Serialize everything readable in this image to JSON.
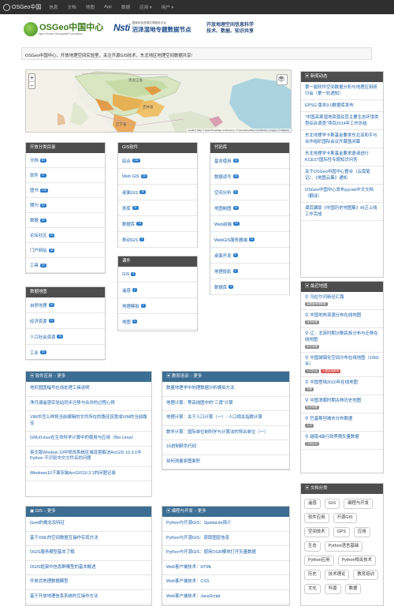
{
  "navbar": {
    "brand": "OSGeo中国",
    "items": [
      "信息",
      "文档",
      "地图",
      "App",
      "数据",
      "应用 ▾",
      "用户 ▾"
    ]
  },
  "header": {
    "osgeo_title_a": "OSGeo",
    "osgeo_title_b": "中国中心",
    "osgeo_sub": "Open Source Geospatial Foundation",
    "nsti_logo": "Nsti",
    "nsti_sub1": "国家科技资源共享服务平台",
    "nsti_sub2": "沼泽湿地专题数据节点",
    "slogan_line1": "开放地理空间信息科学",
    "slogan_line2": "技术、数据、知识共享"
  },
  "intro": "OSGeo中国中心，开放地理空间实验室，关注开源GIS技术，东北地区地理空间数据共享!",
  "map": {
    "zoom_in": "+",
    "zoom_out": "−",
    "attribution": "Leaflet | Map © OpenStreetMap contributors, © OpenStreetMap contributors, Imagery © Mapbox",
    "place_labels": [
      "黑龙江省",
      "吉林省",
      "辽宁省"
    ]
  },
  "panels": {
    "category": {
      "title": "开放分类目录",
      "items": [
        {
          "label": "文档",
          "count": "80"
        },
        {
          "label": "软件",
          "count": "27"
        },
        {
          "label": "图书",
          "count": "138"
        },
        {
          "label": "期刊",
          "count": "40"
        },
        {
          "label": "数据",
          "count": "25"
        },
        {
          "label": "论坛社区",
          "count": "10"
        },
        {
          "label": "门户网站",
          "count": "36"
        },
        {
          "label": "工具",
          "count": "20"
        }
      ]
    },
    "gis_soft": {
      "title": "GIS软件",
      "items": [
        {
          "label": "综合",
          "count": "182"
        },
        {
          "label": "Web GIS",
          "count": "34"
        },
        {
          "label": "桌面GIS",
          "count": "25"
        },
        {
          "label": "类库",
          "count": "31"
        },
        {
          "label": "数据库",
          "count": "13"
        },
        {
          "label": "移动GIS",
          "count": "9"
        }
      ]
    },
    "codebase": {
      "title": "代码库",
      "items": [
        {
          "label": "基本使用",
          "count": "22"
        },
        {
          "label": "数据读写",
          "count": "18"
        },
        {
          "label": "空间分析",
          "count": "8"
        },
        {
          "label": "地图制图",
          "count": "14"
        },
        {
          "label": "Web前端",
          "count": "19"
        },
        {
          "label": "WebGIS服务器端",
          "count": "11"
        },
        {
          "label": "桌面开发",
          "count": "5"
        },
        {
          "label": "地理投影",
          "count": "4"
        },
        {
          "label": "数据库",
          "count": "6"
        }
      ]
    },
    "courses": {
      "title": "课件",
      "items": [
        {
          "label": "GIS",
          "count": "3"
        },
        {
          "label": "遥感",
          "count": "2"
        },
        {
          "label": "地理模拟",
          "count": "2"
        },
        {
          "label": "地图",
          "count": "4"
        }
      ]
    },
    "dataset": {
      "title": "数据地图",
      "items": [
        {
          "label": "自然地理",
          "count": "42"
        },
        {
          "label": "经济资源",
          "count": "21"
        },
        {
          "label": "人口社会资源",
          "count": "38"
        },
        {
          "label": "工业",
          "count": "30"
        }
      ]
    },
    "news": {
      "title": "新闻动态",
      "items": [
        "第一届软件空间数据分析与地理应用研讨会（第一轮通知）",
        "EPSG 版本9.0数据库发布",
        "\"中国高寒湿地资源及其主要生态环境类型综合调查\"项目2014年工作总结",
        "东北地理学卡斯基金要求东北亚和平与合作组织国际会议开幕暨闭幕",
        "东北地理学卡斯基金要求邀请进行KCEST国际性专题知识问答",
        "关于OSGeo中国中心整合（云南笔记）、《地图云集》通知",
        "OSGeo中国中心发布pycsw中文文档（翻译）",
        "谭其骧版《中国历史地图集》纠正上线工作完成"
      ]
    },
    "recent_map": {
      "title": "最近地图",
      "items": [
        {
          "label": "乌拉尔河新径汇路",
          "tags": [
            "高精度地理数据"
          ],
          "red": false
        },
        {
          "label": "中国地热资源分布在线地图",
          "tags": [
            "自然地理"
          ],
          "red": false
        },
        {
          "label": "辽、北宋时期沙数民族分布与迁移在线地图",
          "tags": [
            "历史地理"
          ],
          "red": false
        },
        {
          "label": "中国城镇化空间分布在线地图（1992年）",
          "tags": [
            "人口社会",
            "人类活动影响"
          ],
          "red": true
        },
        {
          "label": "中国登陆2010年在线地图",
          "tags": [
            "专题"
          ],
          "red": false
        },
        {
          "label": "中国清朝时期古林历史地图",
          "tags": [
            "历史地理"
          ],
          "red": false
        },
        {
          "label": "巴基斯坦城市分布数据",
          "tags": [
            "人口"
          ],
          "red": false
        },
        {
          "label": "越南4级行政界限矢量数据",
          "tags": [
            "行政区划"
          ],
          "red": false
        }
      ]
    },
    "soft_app": {
      "title": "软件应用 :: 更多",
      "items": [
        "地形图图幅号在线处理工具说明",
        "净月湖遥感实验站同步迁移与合并的过程心得",
        "VIM中怎么样将当前编辑的文件所在的路径设置成VIM的当前路径",
        "GNU/Linux在生命科学计算中的使用与应用（Bio Linux）",
        "英文版Window 10中修改系统区域设置解决ArcGIS 10.3.1中 Python 不识别中文文件名的问题",
        "Windows10下面安装ArcGIS10.3.1的问题记录"
      ]
    },
    "edu": {
      "title": "教育培训 :: 更多",
      "items": [
        "数量地理学中地理数据分析模拟方法",
        "地理计算：等高线图中的\"三度\"计算",
        "地理计算：关于人口计算（一）- 人口相关指数计算",
        "数学计算：国际单位制科学与计算法的导出单位（一）",
        "16进制颜色代码",
        "如何测量原图面积"
      ]
    },
    "gis_more": {
      "title": "GIS :: 更多",
      "items": [
        "Gnet的概念及特征",
        "基于XML的空间数据互操作实现方法",
        "OGIS服务模型基本了解",
        "OGIS框架中信息群模型的基本概述",
        "开放式地理数据模型",
        "基于开放地理信息系统的互操作方法"
      ]
    },
    "prog": {
      "title": "编程与开发 :: 更多",
      "items": [
        "Python与开源GIS：SpatiaLite简介",
        "Python与开源GIS：获取图层信息",
        "Python与开源GIS：使用OGR模块打开矢量数据",
        "Web客户端技术：HTML",
        "Web客户端技术：CSS",
        "Web客户端技术：JavaScript"
      ]
    },
    "doc_cat": {
      "title": "文档分类",
      "tags": [
        "遥感",
        "GIS",
        "编程与开发",
        "软件应用",
        "开源GIS",
        "空间技术",
        "GPS",
        "应用",
        "生态",
        "Python语言基础",
        "Python应用",
        "Python相关技术",
        "历史",
        "技术理论",
        "教育培训",
        "文化",
        "科普",
        "数据"
      ]
    }
  },
  "colors": {
    "accent": "#3c6d92",
    "header_grey": "#4d4d4d",
    "link": "#1a5fa8",
    "badge": "#2a7bc8"
  }
}
